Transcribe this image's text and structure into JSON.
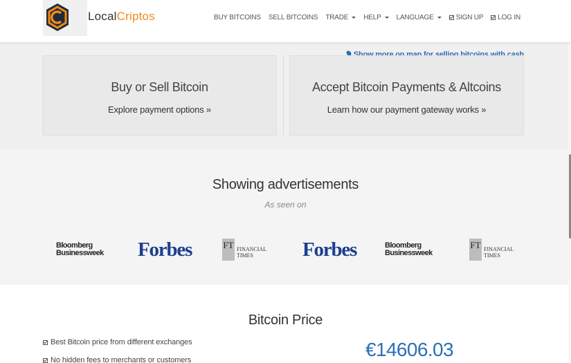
{
  "brand": {
    "name_prefix": "Local",
    "name_suffix": "Criptos",
    "logo_icon": "localcriptos-logo-icon",
    "accent_color": "#f08a1a"
  },
  "nav": {
    "buy": "BUY BITCOINS",
    "sell": "SELL BITCOINS",
    "trade": "TRADE",
    "help": "HELP",
    "language": "LANGUAGE",
    "signup": "SIGN UP",
    "login": "LOG IN"
  },
  "map_link": {
    "text": "Show more on map for selling bitcoins with cash",
    "icon": "map-marker-icon",
    "color": "#2a6fb5"
  },
  "cards": [
    {
      "title": "Buy or Sell Bitcoin",
      "subtitle": "Explore payment options »"
    },
    {
      "title": "Accept Bitcoin Payments & Altcoins",
      "subtitle": "Learn how our payment gateway works »"
    }
  ],
  "press": {
    "title": "Showing advertisements",
    "subtitle": "As seen on",
    "logos": [
      {
        "line1": "Bloomberg",
        "line2": "Businessweek"
      },
      {
        "text": "Forbes"
      },
      {
        "mark": "FT",
        "line1": "FINANCIAL",
        "line2": "TIMES"
      },
      {
        "text": "Forbes"
      },
      {
        "line1": "Bloomberg",
        "line2": "Businessweek"
      },
      {
        "mark": "FT",
        "line1": "FINANCIAL",
        "line2": "TIMES"
      }
    ]
  },
  "price": {
    "title": "Bitcoin Price",
    "features": [
      "Best Bitcoin price from different exchanges",
      "No hidden fees to merchants or customers"
    ],
    "value": "€14606.03",
    "color": "#2a6fb5"
  }
}
